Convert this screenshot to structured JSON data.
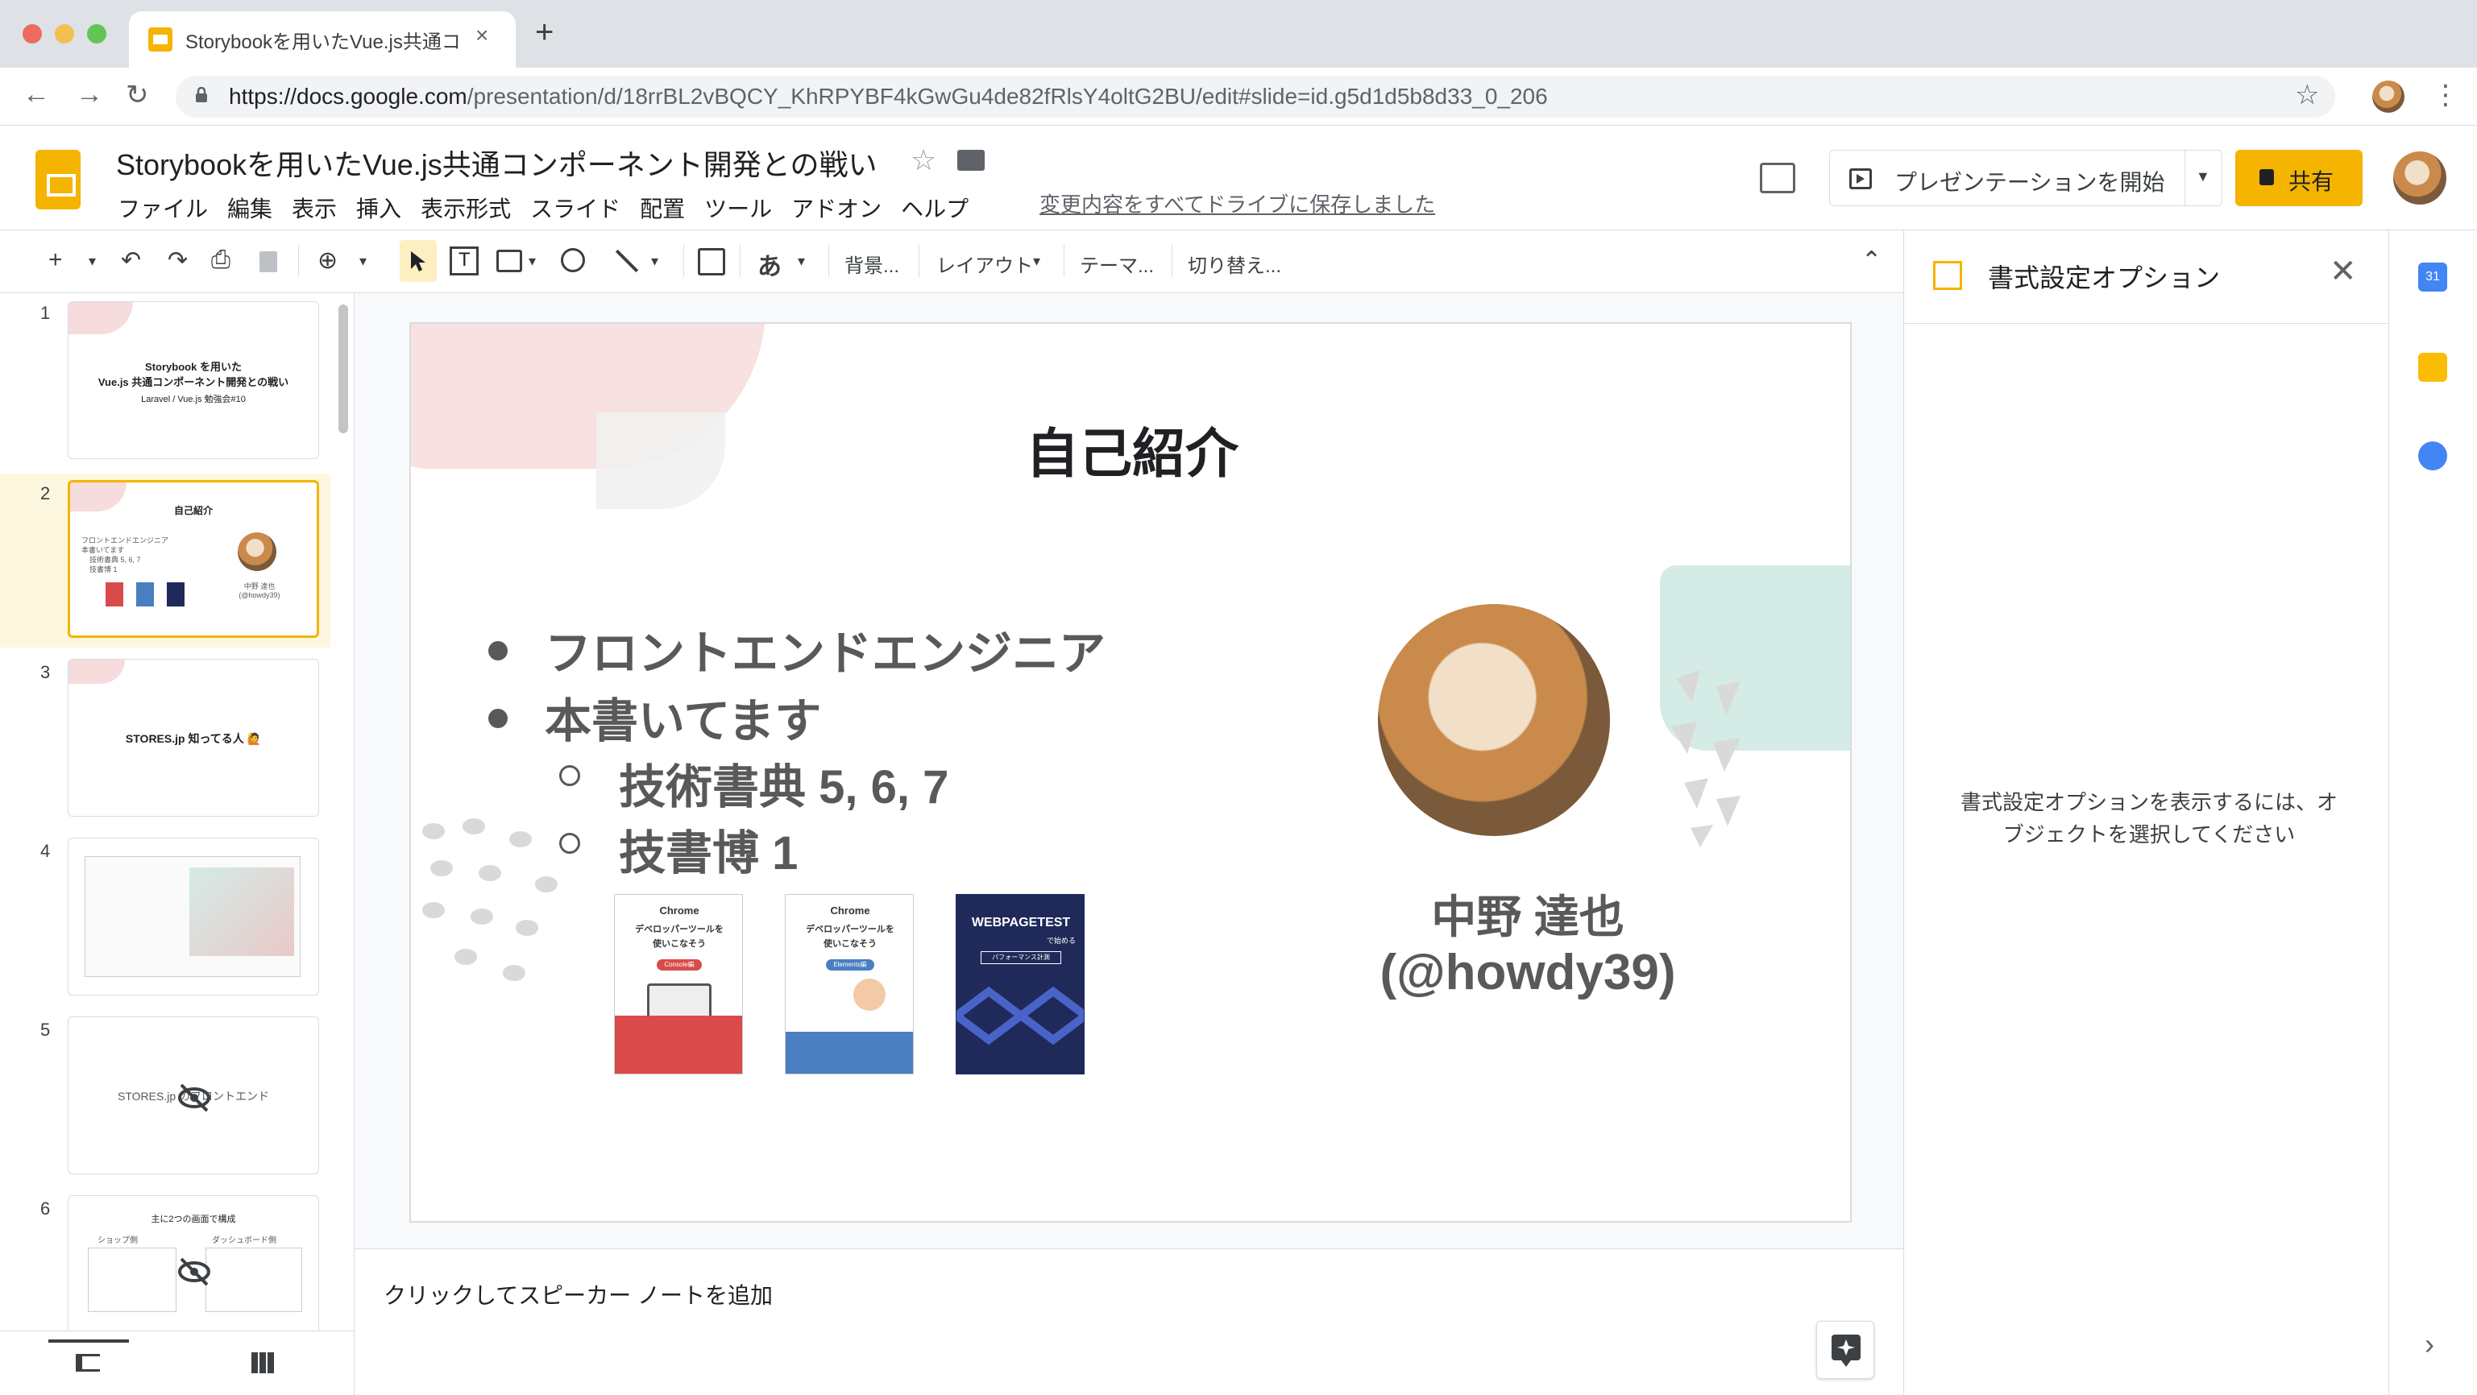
{
  "browser": {
    "tab_title": "Storybookを用いたVue.js共通コ",
    "tab_close": "×",
    "new_tab": "+",
    "url_host": "https://docs.google.com",
    "url_path": "/presentation/d/18rrBL2vBQCY_KhRPYBF4kGwGu4de82fRlsY4oltG2BU/edit#slide=id.g5d1d5b8d33_0_206",
    "back": "←",
    "forward": "→",
    "reload": "↻",
    "star": "☆",
    "kebab": "⋮"
  },
  "app": {
    "title": "Storybookを用いたVue.js共通コンポーネント開発との戦い",
    "title_star": "☆",
    "menus": [
      "ファイル",
      "編集",
      "表示",
      "挿入",
      "表示形式",
      "スライド",
      "配置",
      "ツール",
      "アドオン",
      "ヘルプ"
    ],
    "saved_status": "変更内容をすべてドライブに保存しました",
    "present_label": "プレゼンテーションを開始",
    "present_dropdown": "▼",
    "share_label": "共有"
  },
  "toolbar": {
    "new": "+",
    "undo": "↶",
    "redo": "↷",
    "print": "⎙",
    "zoom": "⊕",
    "text_tool": "T",
    "input_tool": "あ",
    "background": "背景...",
    "layout": "レイアウト",
    "theme": "テーマ...",
    "transition": "切り替え...",
    "collapse": "⌃",
    "dropdown": "▾"
  },
  "filmstrip": {
    "slides": [
      {
        "num": "1",
        "title": "Storybook を用いた\nVue.js 共通コンポーネント開発との戦い",
        "sub": "Laravel / Vue.js 勉強会#10"
      },
      {
        "num": "2",
        "title": "自己紹介"
      },
      {
        "num": "3",
        "title": "STORES.jp 知ってる人 🙋"
      },
      {
        "num": "4",
        "title": ""
      },
      {
        "num": "5",
        "title": "STORES.jp のフロントエンド"
      },
      {
        "num": "6",
        "title": "主に2つの画面で構成"
      }
    ],
    "thumb2_bullets": [
      "フロントエンドエンジニア",
      "本書いてます",
      "技術書典 5, 6, 7",
      "技書博 1"
    ],
    "thumb2_name": "中野 達也\n(@howdy39)",
    "thumb6_left": "ショップ側",
    "thumb6_right": "ダッシュボード側"
  },
  "slide": {
    "title": "自己紹介",
    "bullets": [
      "フロントエンドエンジニア",
      "本書いてます"
    ],
    "sub_bullets": [
      "技術書典 5, 6, 7",
      "技書博 1"
    ],
    "name": "中野 達也",
    "handle": "(@howdy39)",
    "books": [
      {
        "top": "Chrome",
        "title": "デベロッパーツールを\n使いこなそう",
        "tag": "Console編",
        "color": "#d94b4b"
      },
      {
        "top": "Chrome",
        "title": "デベロッパーツールを\n使いこなそう",
        "tag": "Elements編",
        "color": "#4a7fc1"
      },
      {
        "top": "WEBPAGETEST",
        "title": "で始める",
        "tag": "パフォーマンス計測",
        "color": "#1f2a5a"
      }
    ]
  },
  "notes": {
    "placeholder": "クリックしてスピーカー ノートを追加"
  },
  "format_panel": {
    "title": "書式設定オプション",
    "close": "✕",
    "message": "書式設定オプションを表示するには、オブジェクトを選択してください"
  },
  "rail": {
    "calendar_day": "31",
    "expand": "›"
  },
  "colors": {
    "accent": "#f4b400",
    "chrome_bg": "#dee1e6",
    "slide_text": "#595959",
    "mint": "#d4ebe6",
    "pink": "#f6dcdc"
  }
}
